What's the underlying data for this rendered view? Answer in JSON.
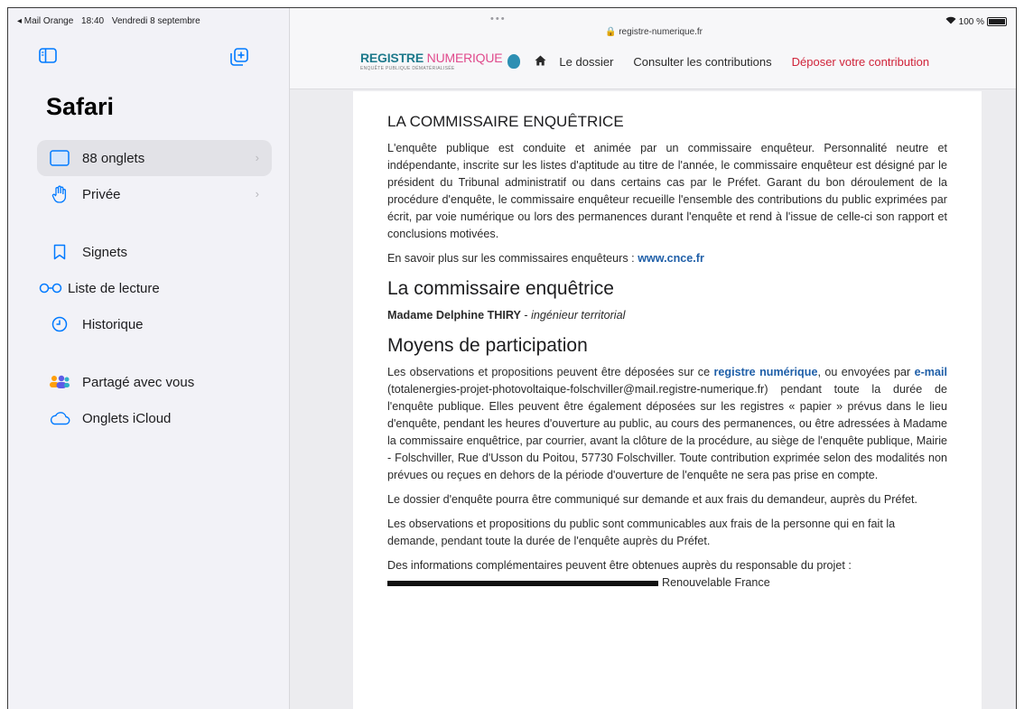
{
  "status": {
    "carrier": "◂ Mail Orange",
    "time": "18:40",
    "date": "Vendredi 8 septembre",
    "battery": "100 %"
  },
  "sidebar": {
    "title": "Safari",
    "items": [
      {
        "label": "88 onglets",
        "icon": "tabs-icon",
        "chevron": "›"
      },
      {
        "label": "Privée",
        "icon": "hand-icon",
        "chevron": "›"
      },
      {
        "label": "Signets",
        "icon": "bookmark-icon"
      },
      {
        "label": "Liste de lecture",
        "icon": "glasses-icon"
      },
      {
        "label": "Historique",
        "icon": "clock-icon"
      },
      {
        "label": "Partagé avec vous",
        "icon": "people-icon"
      },
      {
        "label": "Onglets iCloud",
        "icon": "cloud-icon"
      }
    ]
  },
  "browser": {
    "dots": "•••",
    "url": "🔒 registre-numerique.fr"
  },
  "site": {
    "logo_part1": "REGISTRE ",
    "logo_part2": "NUMERIQUE",
    "logo_tagline": "ENQUÊTE PUBLIQUE DÉMATÉRIALISÉE",
    "nav": [
      {
        "label": "Le dossier"
      },
      {
        "label": "Consulter les contributions"
      },
      {
        "label": "Déposer votre contribution"
      }
    ]
  },
  "article": {
    "heading1": "LA COMMISSAIRE ENQUÊTRICE",
    "para1": "L'enquête publique est conduite et animée par un commissaire enquêteur. Personnalité neutre et indépendante, inscrite sur les listes d'aptitude au titre de l'année, le commissaire enquêteur est désigné par le président du Tribunal administratif ou dans certains cas par le Préfet. Garant du bon déroulement de la procédure d'enquête, le commissaire enquêteur recueille l'ensemble des contributions du public exprimées par écrit, par voie numérique ou lors des permanences durant l'enquête et rend à l'issue de celle-ci son rapport et conclusions motivées.",
    "para2_prefix": "En savoir plus sur les commissaires enquêteurs : ",
    "para2_link": "www.cnce.fr",
    "heading2": "La commissaire enquêtrice",
    "person_name": "Madame Delphine THIRY",
    "person_sep": " - ",
    "person_role": "ingénieur territorial",
    "heading3": "Moyens de participation",
    "para3_a": "Les observations et propositions peuvent être déposées sur ce ",
    "para3_link1": "registre numérique",
    "para3_b": ", ou envoyées par ",
    "para3_link2": "e-mail",
    "para3_c": " (totalenergies-projet-photovoltaique-folschviller@mail.registre-numerique.fr) pendant toute la durée de l'enquête publique. Elles peuvent être également déposées sur les registres « papier » prévus dans le lieu d'enquête, pendant les heures d'ouverture au public, au cours des permanences, ou être adressées à Madame la commissaire enquêtrice, par courrier, avant la clôture de la procédure, au siège de l'enquête publique, Mairie - Folschviller, Rue d'Usson du Poitou, 57730 Folschviller. Toute contribution exprimée selon des modalités non prévues ou reçues en dehors de la période d'ouverture de l'enquête ne sera pas prise en compte.",
    "para4": "Le dossier d'enquête pourra être communiqué sur demande et aux frais du demandeur, auprès du Préfet.",
    "para5": "Les observations et propositions du public sont communicables aux frais de la personne qui en fait la demande, pendant toute la durée de l'enquête auprès du Préfet.",
    "para6": "Des informations complémentaires peuvent être obtenues auprès du responsable du projet :",
    "para7_tail": "Renouvelable France"
  }
}
